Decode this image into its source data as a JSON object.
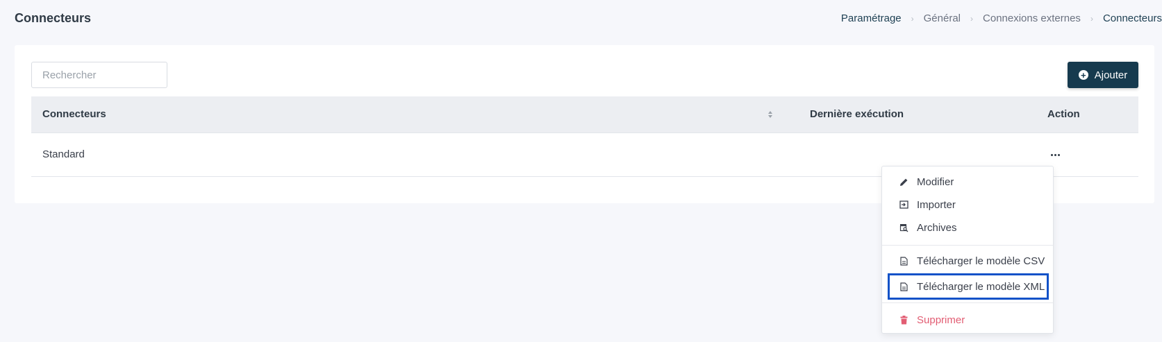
{
  "header": {
    "title": "Connecteurs",
    "breadcrumb": [
      "Paramétrage",
      "Général",
      "Connexions externes",
      "Connecteurs"
    ]
  },
  "toolbar": {
    "search_placeholder": "Rechercher",
    "add_label": "Ajouter"
  },
  "table": {
    "columns": [
      "Connecteurs",
      "Dernière exécution",
      "Action"
    ],
    "rows": [
      {
        "name": "Standard",
        "last_run": ""
      }
    ]
  },
  "action_menu": {
    "items": [
      {
        "label": "Modifier",
        "icon": "pencil-icon"
      },
      {
        "label": "Importer",
        "icon": "import-icon"
      },
      {
        "label": "Archives",
        "icon": "archive-search-icon"
      },
      {
        "label": "Télécharger le modèle CSV",
        "icon": "file-icon"
      },
      {
        "label": "Télécharger le modèle XML",
        "icon": "file-icon"
      },
      {
        "label": "Supprimer",
        "icon": "trash-icon"
      }
    ]
  },
  "colors": {
    "primary": "#163a4e",
    "danger": "#e25d73",
    "highlight": "#1252c8"
  }
}
